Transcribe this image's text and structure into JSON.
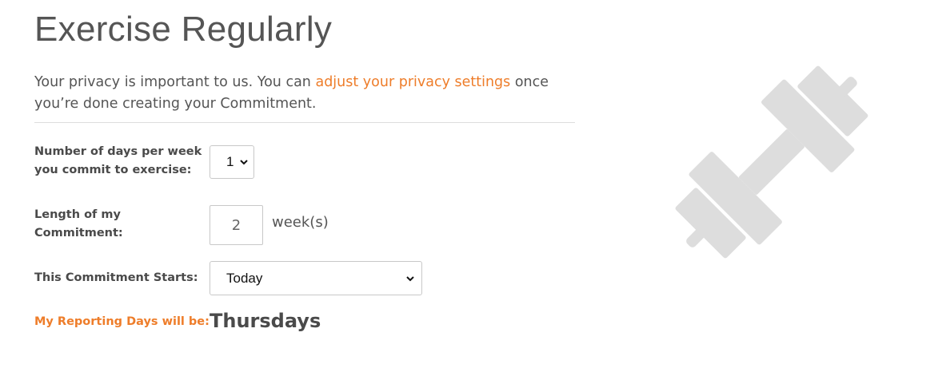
{
  "page_title": "Exercise Regularly",
  "privacy": {
    "text_before": "Your privacy is important to us. You can ",
    "link": "adjust your privacy settings",
    "text_after": " once you’re done creating your Commitment."
  },
  "days_per_week": {
    "label": "Number of days per week you commit to exercise:",
    "value": "1",
    "chevron_icon": "chevron-down-icon"
  },
  "length": {
    "label": "Length of my Commitment:",
    "value": "2",
    "unit": "week(s)"
  },
  "starts": {
    "label": "This Commitment Starts:",
    "value": "Today",
    "chevron_icon": "chevron-down-icon"
  },
  "reporting": {
    "label": "My Reporting Days will be:",
    "value": "Thursdays"
  },
  "illustration": {
    "icon": "dumbbell-icon",
    "color": "#dddddd"
  },
  "colors": {
    "accent": "#ee7d2a",
    "text": "#555555",
    "label": "#4a4a4a"
  }
}
